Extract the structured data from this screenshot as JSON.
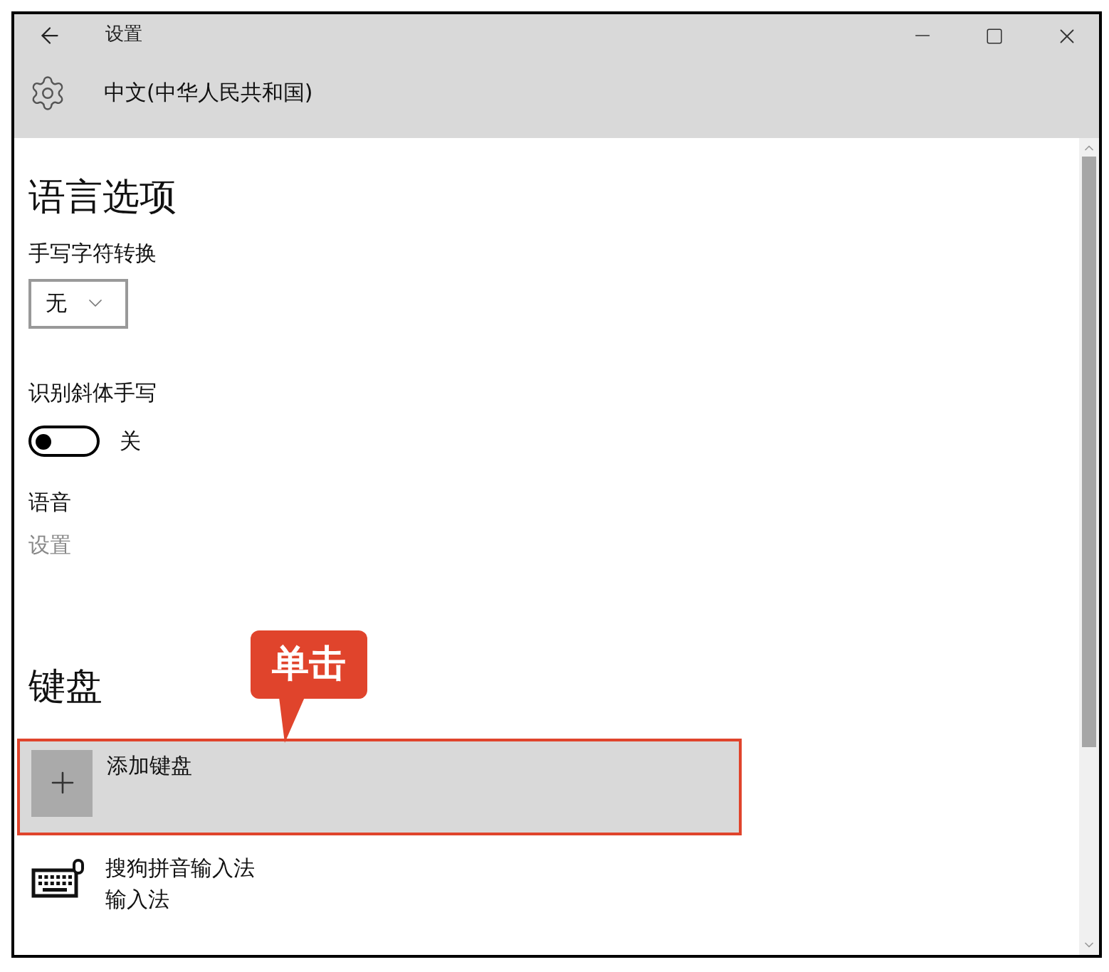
{
  "window": {
    "title": "设置"
  },
  "header": {
    "title": "中文(中华人民共和国)"
  },
  "language_options": {
    "heading": "语言选项",
    "handwriting": {
      "label": "手写字符转换",
      "value": "无"
    },
    "italic": {
      "label": "识别斜体手写",
      "on": false,
      "state_text": "关"
    },
    "speech": {
      "label": "语音",
      "link": "设置"
    }
  },
  "keyboard": {
    "heading": "键盘",
    "add": {
      "label": "添加键盘",
      "highlighted": true
    },
    "items": [
      {
        "name": "搜狗拼音输入法",
        "subtitle": "输入法"
      }
    ]
  },
  "callout": {
    "text": "单击"
  }
}
